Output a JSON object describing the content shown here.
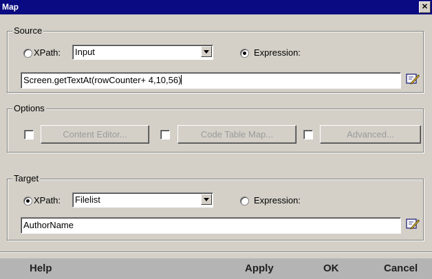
{
  "window": {
    "title": "Map",
    "close_glyph": "✕"
  },
  "source": {
    "legend": "Source",
    "xpath_label": "XPath:",
    "xpath_selected": false,
    "xpath_value": "Input",
    "expression_label": "Expression:",
    "expression_selected": true,
    "expression_value": "Screen.getTextAt(rowCounter+ 4,10,56)"
  },
  "options": {
    "legend": "Options",
    "buttons": [
      {
        "label": "Content Editor..."
      },
      {
        "label": "Code Table Map..."
      },
      {
        "label": "Advanced..."
      }
    ]
  },
  "target": {
    "legend": "Target",
    "xpath_label": "XPath:",
    "xpath_selected": true,
    "xpath_value": "Filelist",
    "expression_label": "Expression:",
    "expression_selected": false,
    "expression_value": "AuthorName"
  },
  "footer": {
    "help": "Help",
    "apply": "Apply",
    "ok": "OK",
    "cancel": "Cancel"
  },
  "icons": {
    "edit_icon": "edit-pencil-icon",
    "dropdown": "chevron-down-icon"
  }
}
